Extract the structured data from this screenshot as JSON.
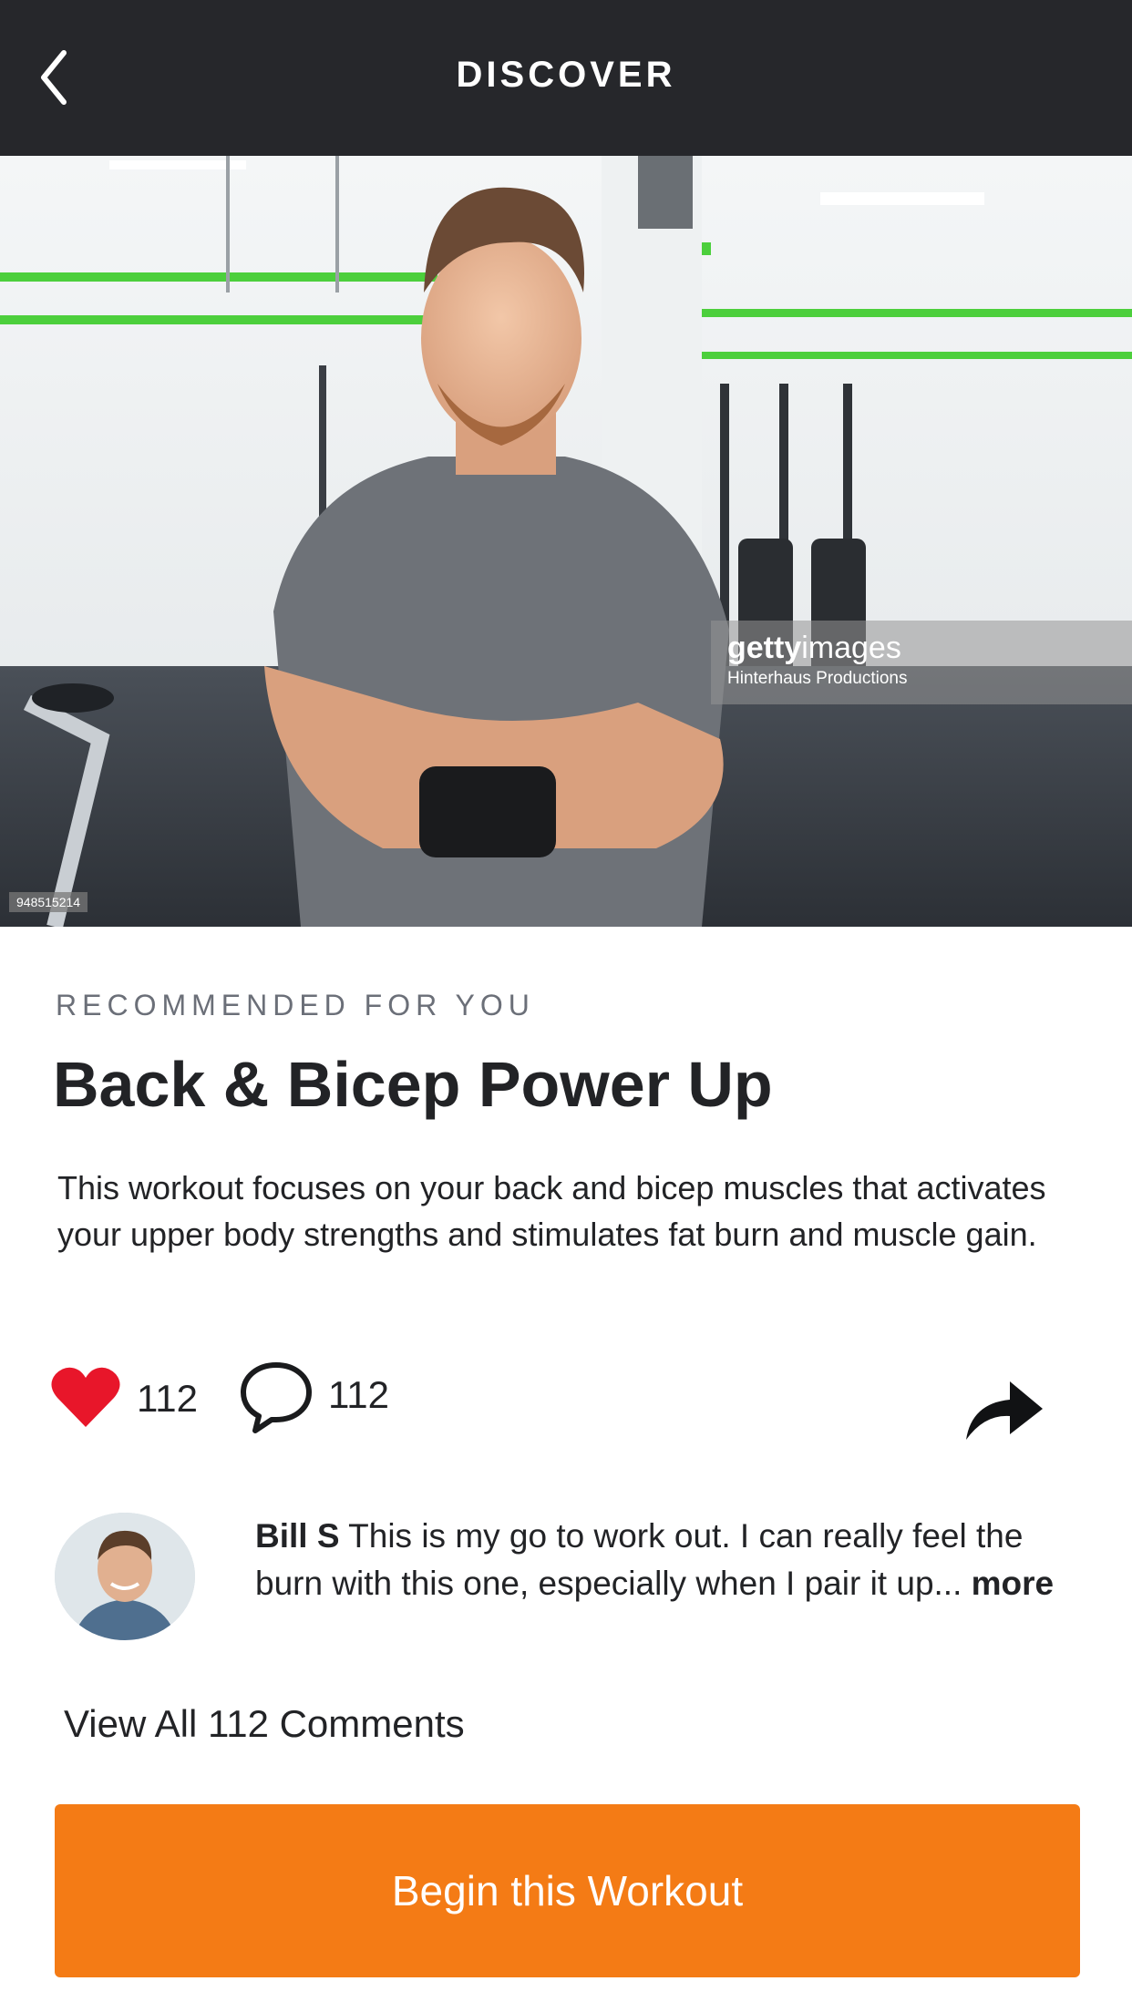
{
  "header": {
    "title": "DISCOVER",
    "back_icon": "chevron-left-icon"
  },
  "hero": {
    "watermark_brand_bold": "getty",
    "watermark_brand_rest": "images",
    "watermark_credit": "Hinterhaus Productions",
    "image_id": "948515214"
  },
  "workout": {
    "eyebrow": "RECOMMENDED FOR YOU",
    "title": "Back & Bicep Power Up",
    "description": "This workout focuses on your back and bicep muscles that activates your upper body strengths and stimulates fat burn and muscle gain."
  },
  "actions": {
    "like_icon": "heart-icon",
    "like_count": "112",
    "comment_icon": "speech-bubble-icon",
    "comment_count": "112",
    "share_icon": "share-arrow-icon"
  },
  "comment_preview": {
    "author": "Bill S",
    "text": " This is my go to work out. I can really feel the burn with this one, especially when I pair it up... ",
    "more_label": "more"
  },
  "view_all_label": "View All 112 Comments",
  "cta_label": "Begin this Workout",
  "colors": {
    "navbar": "#26272b",
    "accent": "#f47b15",
    "like": "#e8162a",
    "text": "#222326",
    "eyebrow": "#6b6f78"
  }
}
